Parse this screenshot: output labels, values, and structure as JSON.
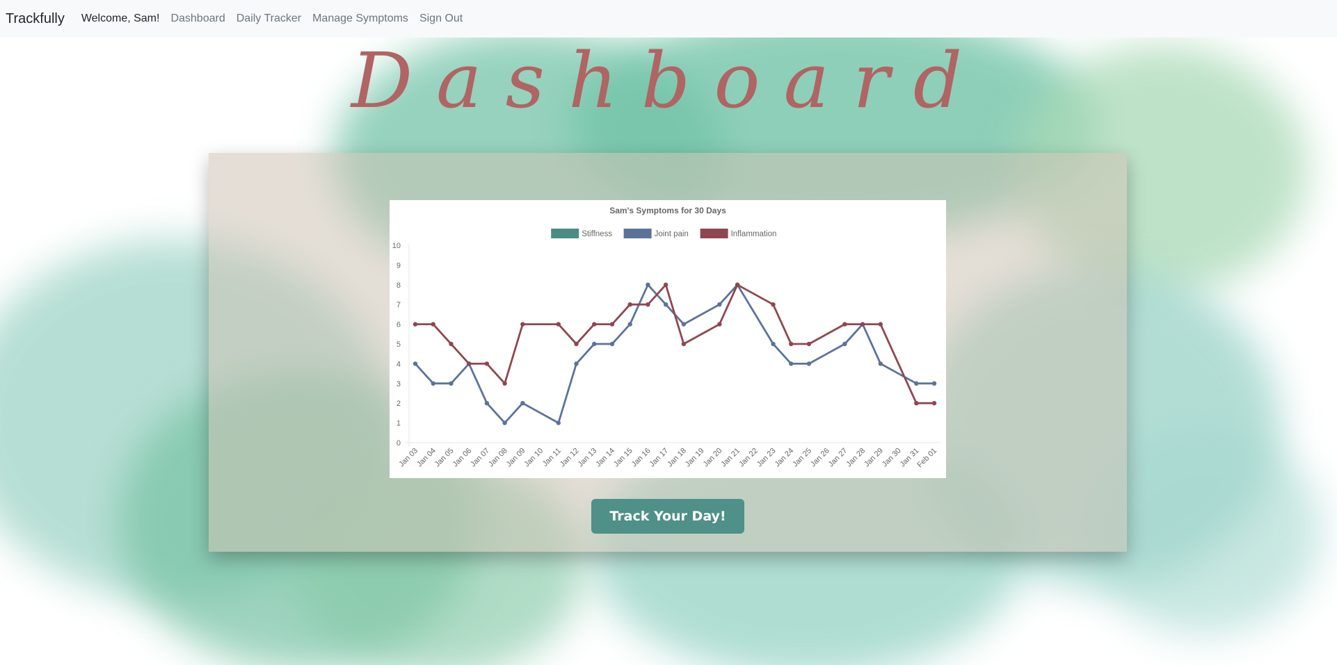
{
  "navbar": {
    "brand": "Trackfully",
    "welcome": "Welcome, Sam!",
    "links": [
      "Dashboard",
      "Daily Tracker",
      "Manage Symptoms",
      "Sign Out"
    ]
  },
  "page_title": "Dashboard",
  "button_label": "Track Your Day!",
  "colors": {
    "accent": "#4f9088",
    "title": "#b06464",
    "stiffness": "#4a8c84",
    "joint_pain": "#5b7398",
    "inflammation": "#8e4750"
  },
  "chart_data": {
    "type": "line",
    "title": "Sam's Symptoms for 30 Days",
    "xlabel": "",
    "ylabel": "",
    "ylim": [
      0,
      10
    ],
    "yticks": [
      0,
      1,
      2,
      3,
      4,
      5,
      6,
      7,
      8,
      9,
      10
    ],
    "legend_position": "top",
    "grid": false,
    "categories": [
      "Jan 03",
      "Jan 04",
      "Jan 05",
      "Jan 06",
      "Jan 07",
      "Jan 08",
      "Jan 09",
      "Jan 10",
      "Jan 11",
      "Jan 12",
      "Jan 13",
      "Jan 14",
      "Jan 15",
      "Jan 16",
      "Jan 17",
      "Jan 18",
      "Jan 19",
      "Jan 20",
      "Jan 21",
      "Jan 22",
      "Jan 23",
      "Jan 24",
      "Jan 25",
      "Jan 26",
      "Jan 27",
      "Jan 28",
      "Jan 29",
      "Jan 30",
      "Jan 31",
      "Feb 01"
    ],
    "series": [
      {
        "name": "Stiffness",
        "color": "#4a8c84",
        "values": []
      },
      {
        "name": "Joint pain",
        "color": "#5b7398",
        "values": [
          4,
          3,
          3,
          4,
          2,
          1,
          2,
          null,
          1,
          4,
          5,
          5,
          6,
          8,
          7,
          6,
          null,
          7,
          8,
          null,
          5,
          4,
          4,
          null,
          5,
          6,
          4,
          null,
          3,
          3
        ]
      },
      {
        "name": "Inflammation",
        "color": "#8e4750",
        "values": [
          6,
          6,
          5,
          4,
          4,
          3,
          6,
          null,
          6,
          5,
          6,
          6,
          7,
          7,
          8,
          5,
          null,
          6,
          8,
          null,
          7,
          5,
          5,
          null,
          6,
          6,
          6,
          null,
          2,
          2
        ]
      }
    ]
  }
}
